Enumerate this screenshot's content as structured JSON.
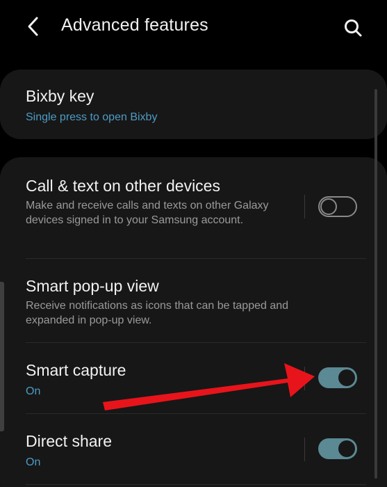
{
  "header": {
    "title": "Advanced features",
    "back_icon": "chevron-left-icon",
    "search_icon": "search-icon"
  },
  "bixby": {
    "title": "Bixby key",
    "subtitle": "Single press to open Bixby"
  },
  "features": [
    {
      "title": "Call & text on other devices",
      "subtitle": "Make and receive calls and texts on other Galaxy devices signed in to your Samsung account.",
      "toggle": "off"
    },
    {
      "title": "Smart pop-up view",
      "subtitle": "Receive notifications as icons that can be tapped and expanded in pop-up view."
    },
    {
      "title": "Smart capture",
      "subtitle": "On",
      "toggle": "on"
    },
    {
      "title": "Direct share",
      "subtitle": "On",
      "toggle": "on"
    }
  ],
  "colors": {
    "background": "#000000",
    "card": "#171717",
    "accent_text": "#4d9cc6",
    "toggle_on": "#5b8994",
    "annotation_arrow": "#e8141b"
  }
}
